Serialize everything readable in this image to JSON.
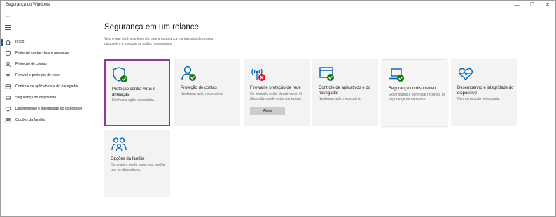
{
  "window": {
    "title": "Segurança do Windows",
    "minimize_glyph": "—",
    "maximize_glyph": "❐",
    "close_glyph": "✕"
  },
  "sidebar": {
    "back_icon": "back-arrow-icon",
    "items": [
      {
        "label": "Início",
        "icon": "home-icon",
        "active": true
      },
      {
        "label": "Proteção contra vírus e ameaças",
        "icon": "shield-icon"
      },
      {
        "label": "Proteção de contas",
        "icon": "person-icon"
      },
      {
        "label": "Firewall e proteção de rede",
        "icon": "wifi-icon"
      },
      {
        "label": "Controle de aplicativos e do navegador",
        "icon": "app-browser-icon"
      },
      {
        "label": "Segurança do dispositivo",
        "icon": "laptop-icon"
      },
      {
        "label": "Desempenho e integridade do dispositivo",
        "icon": "heart-icon"
      },
      {
        "label": "Opções da família",
        "icon": "family-icon"
      }
    ]
  },
  "main": {
    "heading": "Segurança em um relance",
    "subtitle": "Veja o que está acontecendo com a segurança e a integridade do seu dispositivo e execute as ações necessárias.",
    "tiles": [
      {
        "title": "Proteção contra vírus e ameaças",
        "desc": "Nenhuma ação necessária.",
        "icon": "shield-check-icon",
        "status": "ok"
      },
      {
        "title": "Proteção de contas",
        "desc": "Nenhuma ação necessária.",
        "icon": "person-check-icon",
        "status": "ok"
      },
      {
        "title": "Firewall e proteção de rede",
        "desc": "Os firewalls estão desativados. O dispositivo pode estar vulnerável.",
        "icon": "wifi-error-icon",
        "status": "error",
        "button": "Ativar"
      },
      {
        "title": "Controle de aplicativos e do navegador",
        "desc": "Nenhuma ação necessária.",
        "icon": "app-browser-check-icon",
        "status": "ok"
      },
      {
        "title": "Segurança do dispositivo",
        "desc": "Exibir status e gerenciar recursos de segurança de hardware",
        "icon": "laptop-check-icon",
        "status": "info"
      },
      {
        "title": "Desempenho e integridade do dispositivo",
        "desc": "Nenhuma ação necessária.",
        "icon": "heart-pulse-icon",
        "status": "ok"
      },
      {
        "title": "Opções da família",
        "desc": "Gerencie o modo como sua família usa os dispositivos.",
        "icon": "family-icon",
        "status": "info"
      }
    ]
  },
  "colors": {
    "accent": "#0063b1",
    "ok": "#107c10",
    "error": "#e81123",
    "selection": "#8b3a96"
  }
}
